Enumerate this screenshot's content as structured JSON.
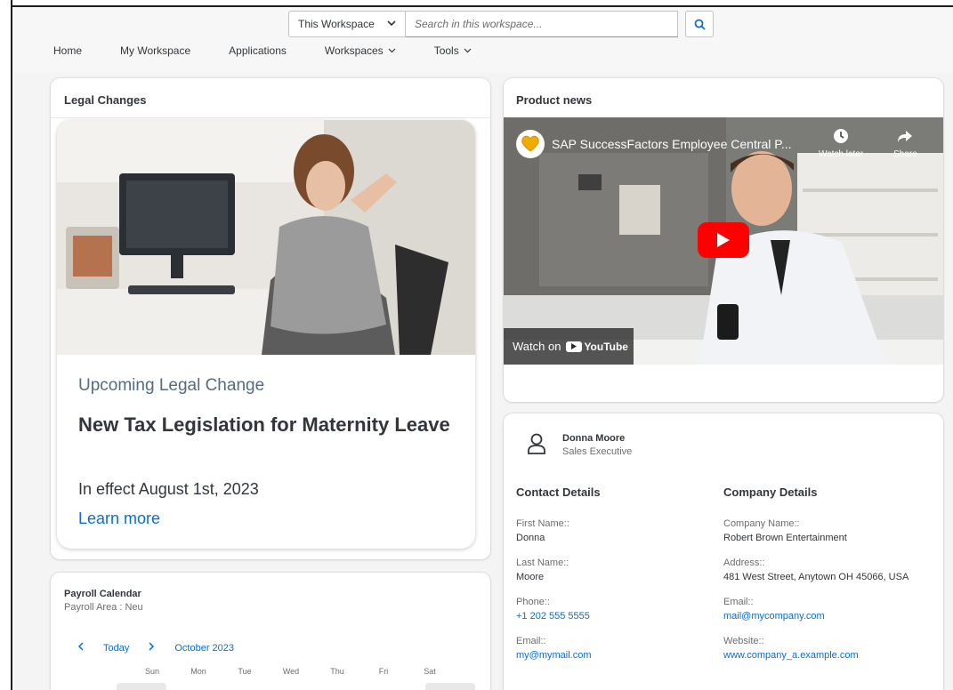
{
  "search": {
    "scope": "This Workspace",
    "placeholder": "Search in this workspace..."
  },
  "nav": {
    "items": [
      {
        "label": "Home",
        "dropdown": false
      },
      {
        "label": "My Workspace",
        "dropdown": false
      },
      {
        "label": "Applications",
        "dropdown": false
      },
      {
        "label": "Workspaces",
        "dropdown": true
      },
      {
        "label": "Tools",
        "dropdown": true
      }
    ]
  },
  "legal": {
    "title": "Legal Changes",
    "subtitle": "Upcoming Legal Change",
    "headline": "New Tax Legislation for Maternity Leave",
    "effective": "In effect August 1st, 2023",
    "link": "Learn more"
  },
  "payroll": {
    "title": "Payroll Calendar",
    "subtitle": "Payroll Area : Neu",
    "today": "Today",
    "month": "October 2023",
    "days": [
      "Sun",
      "Mon",
      "Tue",
      "Wed",
      "Thu",
      "Fri",
      "Sat"
    ]
  },
  "news": {
    "title": "Product news",
    "video_title": "SAP SuccessFactors Employee Central P...",
    "watch_later": "Watch later",
    "share": "Share",
    "watch_on": "Watch on",
    "youtube": "YouTube"
  },
  "contact": {
    "name": "Donna Moore",
    "role": "Sales Executive",
    "contact_title": "Contact Details",
    "company_title": "Company Details",
    "contact_fields": [
      {
        "label": "First Name::",
        "value": "Donna"
      },
      {
        "label": "Last Name::",
        "value": "Moore"
      },
      {
        "label": "Phone::",
        "value": "+1 202 555 5555"
      },
      {
        "label": "Email::",
        "value": "my@mymail.com"
      }
    ],
    "company_fields": [
      {
        "label": "Company Name::",
        "value": "Robert Brown Entertainment"
      },
      {
        "label": "Address::",
        "value": "481 West Street, Anytown OH 45066, USA"
      },
      {
        "label": "Email::",
        "value": "mail@mycompany.com"
      },
      {
        "label": "Website::",
        "value": "www.company_a.example.com"
      }
    ]
  },
  "colors": {
    "link": "#0a6ed1",
    "text": "#32363a",
    "muted": "#6a6d70",
    "background": "#f4f4f4",
    "youtube_red": "#ff0000"
  }
}
